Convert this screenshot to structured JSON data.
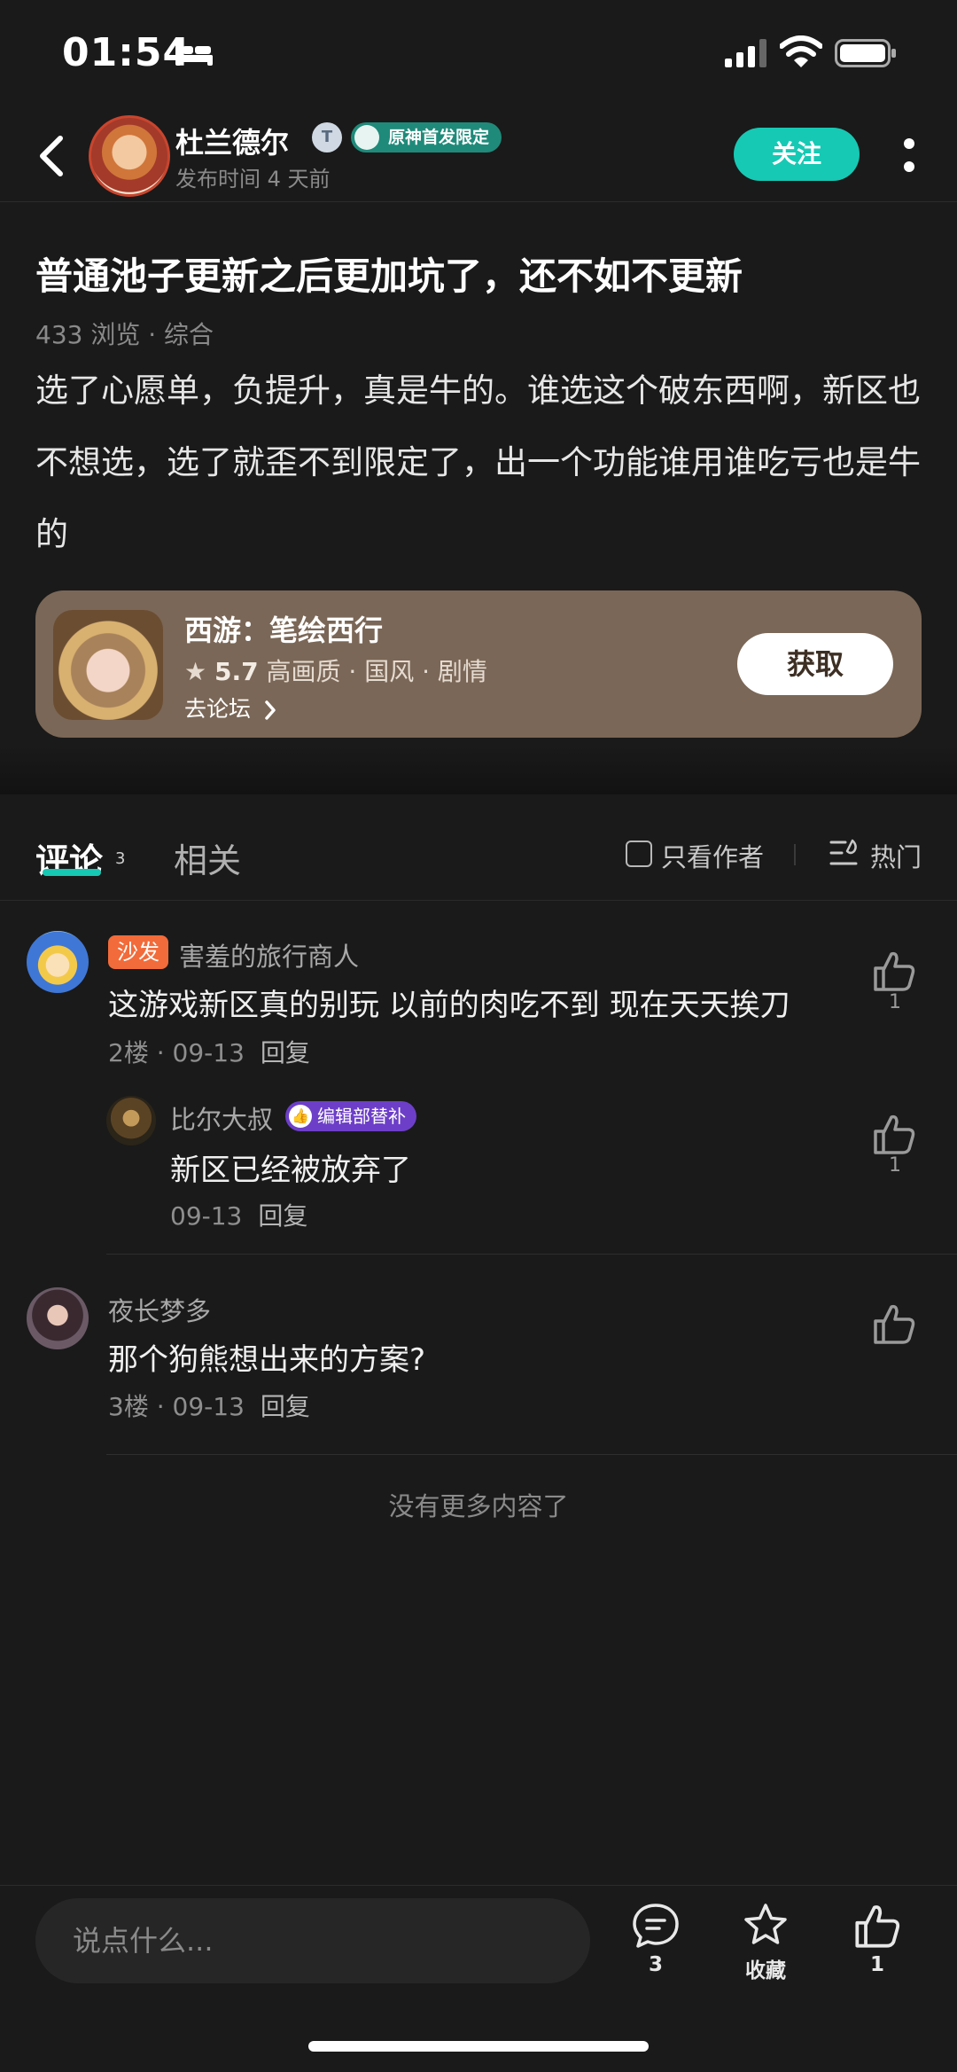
{
  "status_bar": {
    "time": "01:54"
  },
  "header": {
    "author_name": "杜兰德尔",
    "level_badge": "T",
    "genshin_badge": "原神首发限定",
    "post_time": "发布时间 4 天前",
    "follow_label": "关注"
  },
  "post": {
    "title": "普通池子更新之后更加坑了，还不如不更新",
    "meta": "433 浏览 · 综合",
    "body": "选了心愿单，负提升，真是牛的。谁选这个破东西啊，新区也不想选，选了就歪不到限定了，出一个功能谁用谁吃亏也是牛的"
  },
  "game_card": {
    "name": "西游：笔绘西行",
    "star": "★",
    "rating": "5.7",
    "tags": "高画质 · 国风 · 剧情",
    "forum_link": "去论坛",
    "get_label": "获取",
    "background_color": "#7b6757"
  },
  "tabs": {
    "comments_label": "评论",
    "comments_count": "3",
    "related_label": "相关",
    "author_only_label": "只看作者",
    "sort_label": "热门",
    "accent_color": "#16c9b4"
  },
  "comments": [
    {
      "badge": "沙发",
      "username": "害羞的旅行商人",
      "text": "这游戏新区真的别玩 以前的肉吃不到 现在天天挨刀",
      "meta": "2楼 · 09-13",
      "reply_label": "回复",
      "likes": "1"
    },
    {
      "username": "夜长梦多",
      "text": "那个狗熊想出来的方案?",
      "meta": "3楼 · 09-13",
      "reply_label": "回复",
      "likes": ""
    }
  ],
  "reply": {
    "username": "比尔大叔",
    "badge": "编辑部替补",
    "text": "新区已经被放弃了",
    "meta": "09-13",
    "reply_label": "回复",
    "likes": "1"
  },
  "no_more_text": "没有更多内容了",
  "bottom_bar": {
    "input_placeholder": "说点什么...",
    "comment_count": "3",
    "favorite_label": "收藏",
    "like_count": "1"
  }
}
